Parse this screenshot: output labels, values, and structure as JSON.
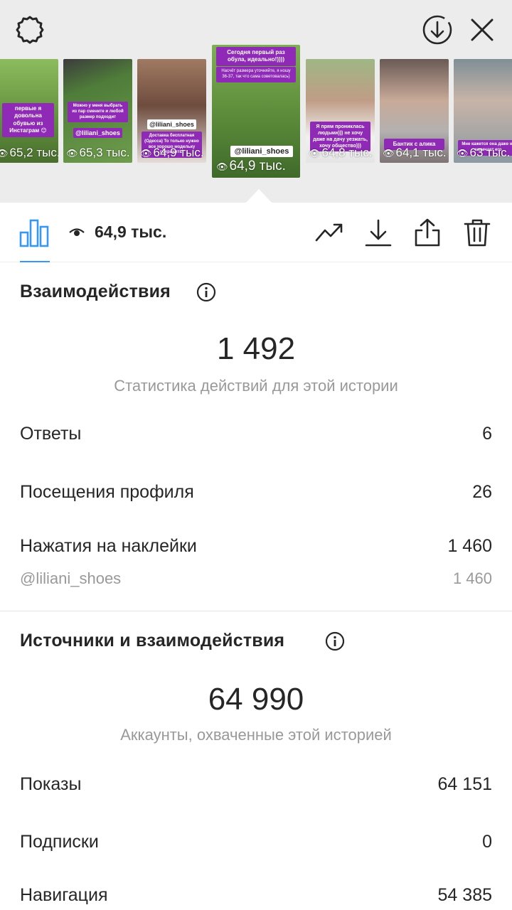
{
  "story_tray": {
    "thumbnails": [
      {
        "views": "65,2 тыс.",
        "caption": "первые я довольна обувью из Инстаграм 😊",
        "sticker": "",
        "bg": "#6f9a4a"
      },
      {
        "views": "65,3 тыс.",
        "caption": "Можно у меня выбрать из пар смените и любой размер подходит",
        "sticker": "@liliani_shoes",
        "bg": "#4f7d3a"
      },
      {
        "views": "64,9 тыс.",
        "caption": "Доставка бесплатная (Одесса) То только нужно все хорошо модельку сохранить!",
        "sticker": "@liliani_shoes",
        "bg": "#7b5a4b"
      },
      {
        "views": "64,9 тыс.",
        "caption": "Сегодня первый раз обула, идеально!))))",
        "caption2": "Насчёт размера уточняйте, я ношу 36-37, так что сама советовалась)",
        "sticker": "@liliani_shoes",
        "bg": "#5e8e3b",
        "active": true
      },
      {
        "views": "64,8 тыс.",
        "caption": "Я прям прониклась людьми))) не хочу даже на дачу уезжать, хочу общество)))",
        "sticker": "",
        "bg": "#7a9b5a"
      },
      {
        "views": "64,1 тыс.",
        "caption": "Бантик с алика",
        "sticker": "",
        "bg": "#9a8a86"
      },
      {
        "views": "63 тыс.",
        "caption": "Мне кажется она даже не замечает его",
        "sticker": "",
        "bg": "#8c9aa2"
      }
    ]
  },
  "toolbar": {
    "views_total": "64,9 тыс."
  },
  "interactions": {
    "title": "Взаимодействия",
    "total": "1 492",
    "caption": "Статистика действий для этой истории",
    "rows": [
      {
        "label": "Ответы",
        "value": "6"
      },
      {
        "label": "Посещения профиля",
        "value": "26"
      },
      {
        "label": "Нажатия на наклейки",
        "value": "1 460"
      }
    ],
    "sub_row": {
      "label": "@liliani_shoes",
      "value": "1 460"
    }
  },
  "discovery": {
    "title": "Источники и взаимодействия",
    "total": "64 990",
    "caption": "Аккаунты, охваченные этой историей",
    "rows": [
      {
        "label": "Показы",
        "value": "64 151"
      },
      {
        "label": "Подписки",
        "value": "0"
      },
      {
        "label": "Навигация",
        "value": "54 385"
      }
    ]
  },
  "colors": {
    "accent": "#3897f0",
    "sticker_purple": "#8e2ab5",
    "text": "#262626",
    "muted": "#999999"
  }
}
